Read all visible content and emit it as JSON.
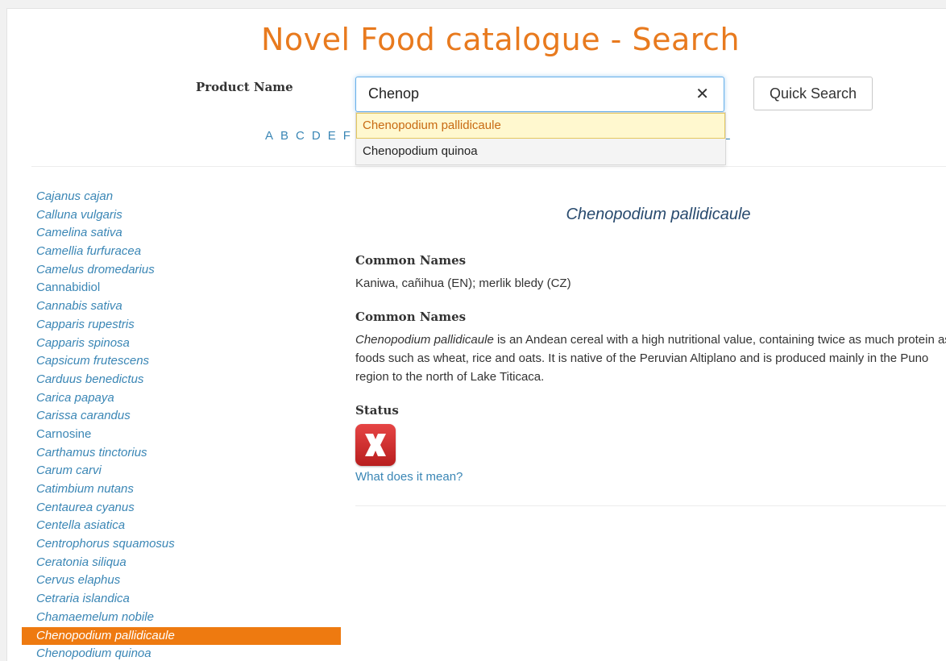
{
  "header": {
    "title": "Novel Food catalogue - Search"
  },
  "search": {
    "label": "Product Name",
    "value": "Chenop",
    "clear_glyph": "✕",
    "button_label": "Quick Search",
    "suggestions": [
      "Chenopodium pallidicaule",
      "Chenopodium quinoa"
    ]
  },
  "alphabet": {
    "letters": [
      "A",
      "B",
      "C",
      "D",
      "E",
      "F"
    ],
    "trailing_letter": "L"
  },
  "sidebar": {
    "items": [
      {
        "label": "Cajanus cajan",
        "italic": true
      },
      {
        "label": "Calluna vulgaris",
        "italic": true
      },
      {
        "label": "Camelina sativa",
        "italic": true
      },
      {
        "label": "Camellia furfuracea",
        "italic": true
      },
      {
        "label": "Camelus dromedarius",
        "italic": true
      },
      {
        "label": "Cannabidiol",
        "italic": false
      },
      {
        "label": "Cannabis sativa",
        "italic": true
      },
      {
        "label": "Capparis rupestris",
        "italic": true
      },
      {
        "label": "Capparis spinosa",
        "italic": true
      },
      {
        "label": "Capsicum frutescens",
        "italic": true
      },
      {
        "label": "Carduus benedictus",
        "italic": true
      },
      {
        "label": "Carica papaya",
        "italic": true
      },
      {
        "label": "Carissa carandus",
        "italic": true
      },
      {
        "label": "Carnosine",
        "italic": false
      },
      {
        "label": "Carthamus tinctorius",
        "italic": true
      },
      {
        "label": "Carum carvi",
        "italic": true
      },
      {
        "label": "Catimbium nutans",
        "italic": true
      },
      {
        "label": "Centaurea cyanus",
        "italic": true
      },
      {
        "label": "Centella asiatica",
        "italic": true
      },
      {
        "label": "Centrophorus squamosus",
        "italic": true
      },
      {
        "label": "Ceratonia siliqua",
        "italic": true
      },
      {
        "label": "Cervus elaphus",
        "italic": true
      },
      {
        "label": "Cetraria islandica",
        "italic": true
      },
      {
        "label": "Chamaemelum nobile",
        "italic": true
      },
      {
        "label": "Chenopodium pallidicaule",
        "italic": true,
        "selected": true
      },
      {
        "label": "Chenopodium quinoa",
        "italic": true
      }
    ]
  },
  "detail": {
    "title": "Chenopodium pallidicaule",
    "common_names_heading": "Common Names",
    "common_names_text": "Kaniwa, cañihua (EN); merlik bledy (CZ)",
    "description_heading": "Common Names",
    "description_species": "Chenopodium pallidicaule",
    "description_text": " is an Andean cereal with a high nutritional value, containing twice as much protein as foods such as wheat, rice and oats. It is native of the Peruvian Altiplano and is produced mainly in the Puno region to the north of Lake Titicaca.",
    "status_heading": "Status",
    "status_icon": "red-x-icon",
    "status_link": "What does it mean?"
  },
  "colors": {
    "title_orange": "#e87a1e",
    "link_blue": "#3a86b5",
    "selected_bg": "#ee7a10",
    "status_red": "#d23030"
  }
}
